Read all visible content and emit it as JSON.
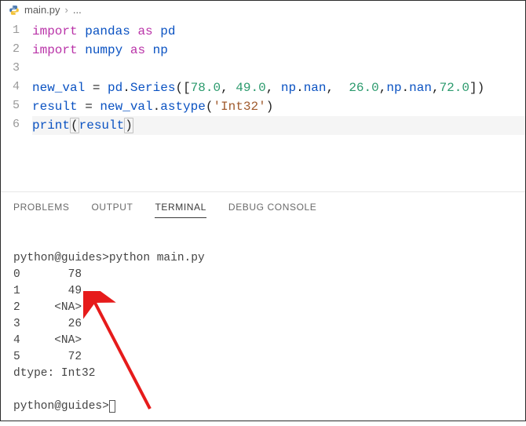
{
  "breadcrumb": {
    "file": "main.py",
    "sep": "›",
    "more": "..."
  },
  "code": {
    "lines": [
      {
        "n": "1"
      },
      {
        "n": "2"
      },
      {
        "n": "3"
      },
      {
        "n": "4"
      },
      {
        "n": "5"
      },
      {
        "n": "6"
      }
    ],
    "kw_import_a": "import",
    "kw_as_a": "as",
    "id_pandas": "pandas",
    "id_pd": "pd",
    "kw_import_b": "import",
    "kw_as_b": "as",
    "id_numpy": "numpy",
    "id_np": "np",
    "id_new_val": "new_val",
    "eq1": " = ",
    "id_pd2": "pd",
    "dot1": ".",
    "id_series": "Series",
    "paren_open1": "(",
    "bracket_open": "[",
    "num78": "78.0",
    "comma_sp": ", ",
    "num49": "49.0",
    "id_np_nan1": "np",
    "dot_nan1": ".",
    "id_nan1": "nan",
    "num26": "26.0",
    "comma": ",",
    "id_np_nan2": "np",
    "dot_nan2": ".",
    "id_nan2": "nan",
    "num72": "72.0",
    "bracket_close": "]",
    "paren_close1": ")",
    "id_result": "result",
    "eq2": " = ",
    "id_new_val2": "new_val",
    "dot2": ".",
    "id_astype": "astype",
    "paren_open2": "(",
    "str_int32": "'Int32'",
    "paren_close2": ")",
    "id_print": "print",
    "paren_open3": "(",
    "id_result2": "result",
    "paren_close3": ")"
  },
  "panel": {
    "tabs": {
      "problems": "PROBLEMS",
      "output": "OUTPUT",
      "terminal": "TERMINAL",
      "debug": "DEBUG CONSOLE"
    }
  },
  "terminal": {
    "line1": "python@guides>python main.py",
    "out0": "0       78",
    "out1": "1       49",
    "out2": "2     <NA>",
    "out3": "3       26",
    "out4": "4     <NA>",
    "out5": "5       72",
    "dtype": "dtype: Int32",
    "prompt2": "python@guides>"
  }
}
